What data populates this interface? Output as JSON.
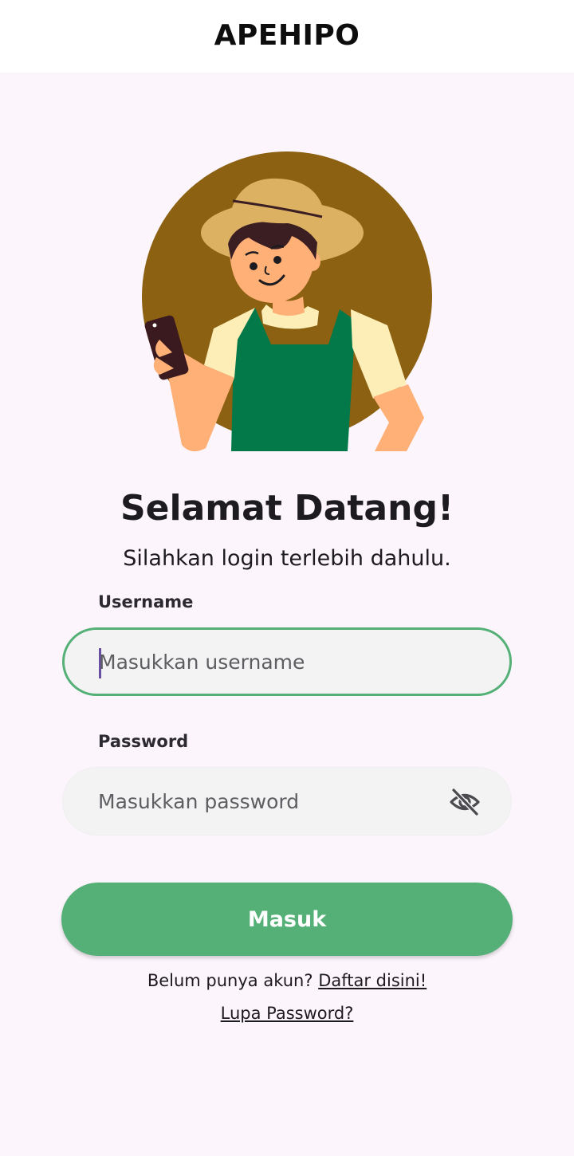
{
  "app_bar": {
    "title": "APEHIPO"
  },
  "illustration": {
    "name": "farmer-with-phone-illustration",
    "colors": {
      "circle": "#8c6112",
      "hat": "#dcb162",
      "skin": "#ffb077",
      "shirt": "#fdedb6",
      "apron": "#037848",
      "hair": "#3a1e22",
      "phone": "#3b1a1f"
    }
  },
  "welcome": {
    "title": "Selamat Datang!",
    "subtitle": "Silahkan login terlebih dahulu."
  },
  "form": {
    "username": {
      "label": "Username",
      "placeholder": "Masukkan username",
      "value": "",
      "focused": true
    },
    "password": {
      "label": "Password",
      "placeholder": "Masukkan password",
      "value": "",
      "visibility_icon": "eye-off-icon"
    },
    "submit_label": "Masuk"
  },
  "footer": {
    "register_prompt": "Belum punya akun?",
    "register_link": "Daftar disini!",
    "forgot_link": "Lupa Password?"
  },
  "colors": {
    "accent_green": "#55b077",
    "background": "#fcf5fc",
    "input_fill": "#f3f3f3",
    "caret": "#6750a4"
  }
}
